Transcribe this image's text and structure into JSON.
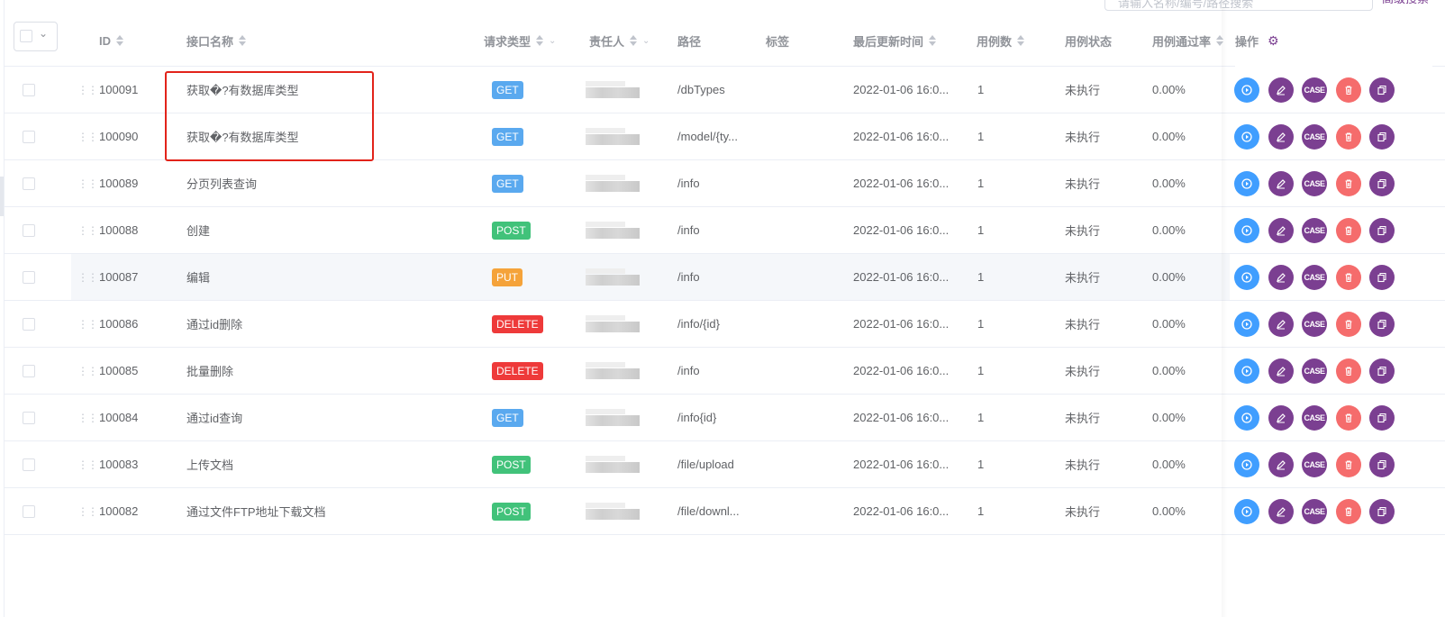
{
  "search": {
    "placeholder": "请输入名称/编号/路径搜索",
    "button_label": "高级搜索"
  },
  "columns": {
    "id": "ID",
    "name": "接口名称",
    "method": "请求类型",
    "owner": "责任人",
    "path": "路径",
    "tags": "标签",
    "updated": "最后更新时间",
    "case_count": "用例数",
    "case_status": "用例状态",
    "pass_rate": "用例通过率",
    "actions": "操作"
  },
  "rows": [
    {
      "id": "100091",
      "name": "获取�?有数据库类型",
      "method": "GET",
      "path": "/dbTypes",
      "updated": "2022-01-06 16:0...",
      "cases": "1",
      "status": "未执行",
      "rate": "0.00%"
    },
    {
      "id": "100090",
      "name": "获取�?有数据库类型",
      "method": "GET",
      "path": "/model/{ty...",
      "updated": "2022-01-06 16:0...",
      "cases": "1",
      "status": "未执行",
      "rate": "0.00%"
    },
    {
      "id": "100089",
      "name": "分页列表查询",
      "method": "GET",
      "path": "/info",
      "updated": "2022-01-06 16:0...",
      "cases": "1",
      "status": "未执行",
      "rate": "0.00%"
    },
    {
      "id": "100088",
      "name": "创建",
      "method": "POST",
      "path": "/info",
      "updated": "2022-01-06 16:0...",
      "cases": "1",
      "status": "未执行",
      "rate": "0.00%"
    },
    {
      "id": "100087",
      "name": "编辑",
      "method": "PUT",
      "path": "/info",
      "updated": "2022-01-06 16:0...",
      "cases": "1",
      "status": "未执行",
      "rate": "0.00%"
    },
    {
      "id": "100086",
      "name": "通过id删除",
      "method": "DELETE",
      "path": "/info/{id}",
      "updated": "2022-01-06 16:0...",
      "cases": "1",
      "status": "未执行",
      "rate": "0.00%"
    },
    {
      "id": "100085",
      "name": "批量删除",
      "method": "DELETE",
      "path": "/info",
      "updated": "2022-01-06 16:0...",
      "cases": "1",
      "status": "未执行",
      "rate": "0.00%"
    },
    {
      "id": "100084",
      "name": "通过id查询",
      "method": "GET",
      "path": "/info{id}",
      "updated": "2022-01-06 16:0...",
      "cases": "1",
      "status": "未执行",
      "rate": "0.00%"
    },
    {
      "id": "100083",
      "name": "上传文档",
      "method": "POST",
      "path": "/file/upload",
      "updated": "2022-01-06 16:0...",
      "cases": "1",
      "status": "未执行",
      "rate": "0.00%"
    },
    {
      "id": "100082",
      "name": "通过文件FTP地址下载文档",
      "method": "POST",
      "path": "/file/downl...",
      "updated": "2022-01-06 16:0...",
      "cases": "1",
      "status": "未执行",
      "rate": "0.00%"
    }
  ],
  "icons": {
    "run": "play-circle-icon",
    "edit": "pencil-icon",
    "case": "case-icon",
    "delete": "trash-icon",
    "copy": "copy-icon",
    "settings": "gear-icon",
    "drag": "drag-handle-icon"
  },
  "case_label": "CASE",
  "colors": {
    "primary": "#7b3f91",
    "run": "#409eff",
    "delete": "#f56c6c",
    "get": "#5aa9ef",
    "post": "#41c27a",
    "put": "#f5a33a",
    "delete_tag": "#ee3a3a",
    "highlight_box": "#e2231a"
  }
}
